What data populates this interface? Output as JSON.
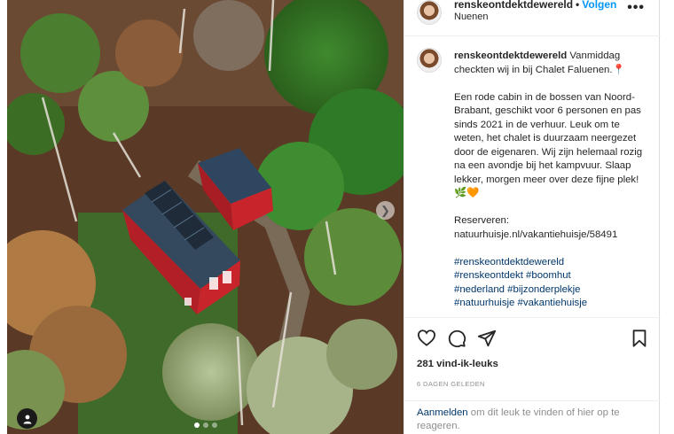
{
  "post": {
    "username": "renskeontdektdewereld",
    "follow_label": "Volgen",
    "separator": "•",
    "location": "Nuenen",
    "more_label": "•••"
  },
  "caption": {
    "username": "renskeontdektdewereld",
    "intro": "Vanmiddag checkten wij in bij Chalet Faluenen.",
    "pin_emoji": "📍",
    "body": "Een rode cabin in de bossen van Noord-Brabant, geschikt voor 6 personen en pas sinds 2021 in de verhuur. Leuk om te weten, het chalet is duurzaam neergezet door de eigenaren. Wij zijn helemaal rozig na een avondje bij het kampvuur. Slaap lekker, morgen meer over deze fijne plek!",
    "body_emoji": "🌿🧡",
    "reserve_label": "Reserveren:",
    "reserve_url": "natuurhuisje.nl/vakantiehuisje/58491",
    "hashtags": [
      "#renskeontdektdewereld",
      "#renskeontdekt #boomhut",
      "#nederland #bijzonderplekje",
      "#natuurhuisje #vakantiehuisje"
    ]
  },
  "actions": {
    "likes": "281 vind-ik-leuks",
    "date": "6 DAGEN GELEDEN"
  },
  "login_prompt": {
    "link": "Aanmelden",
    "text": " om dit leuk te vinden of hier op te reageren."
  },
  "colors": {
    "follow": "#0095f6",
    "link": "#00376b",
    "muted": "#8e8e8e",
    "cabin_red": "#c8242c"
  },
  "icons": {
    "like": "heart-icon",
    "comment": "comment-icon",
    "share": "send-icon",
    "save": "bookmark-icon",
    "next": "chevron-right-icon",
    "tag": "user-tag-icon"
  },
  "carousel": {
    "slide": 1,
    "total": 3
  }
}
